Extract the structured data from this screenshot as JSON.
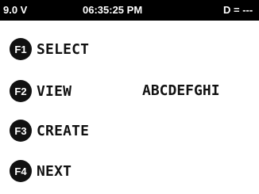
{
  "status_bar": {
    "voltage": "9.0 V",
    "time": "06:35:25 PM",
    "distance": "D = ---"
  },
  "menu": {
    "items": [
      {
        "key": "F1",
        "label": "SELECT"
      },
      {
        "key": "F2",
        "label": "VIEW"
      },
      {
        "key": "F3",
        "label": "CREATE"
      },
      {
        "key": "F4",
        "label": "NEXT"
      }
    ],
    "view_value": "ABCDEFGHI"
  },
  "colors": {
    "status_bar_bg": "#000000",
    "status_bar_text": "#ffffff",
    "fkey_bg": "#111111",
    "text": "#111111",
    "screen_bg": "#ffffff"
  }
}
